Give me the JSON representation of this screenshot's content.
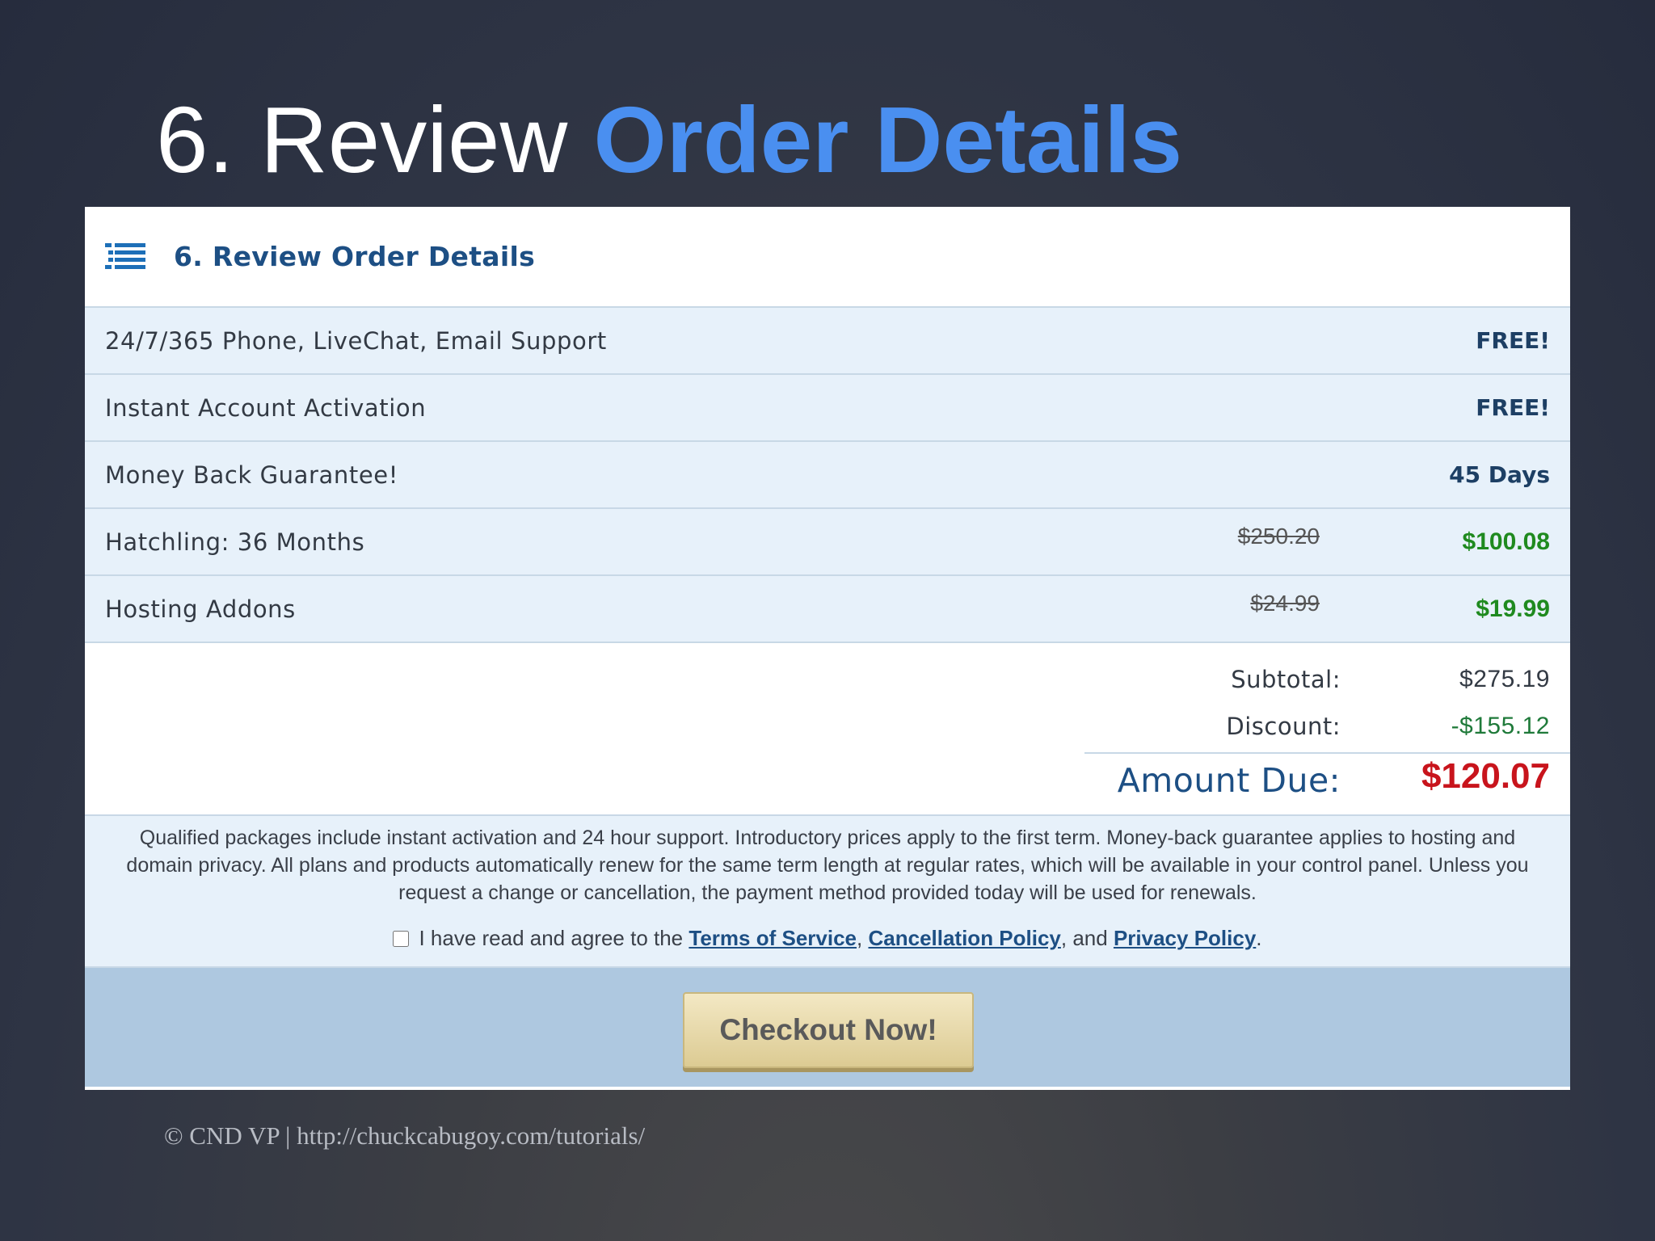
{
  "slide": {
    "title_prefix": "6. Review",
    "title_accent": "Order Details",
    "credit": "© CND VP | http://chuckcabugoy.com/tutorials/"
  },
  "panel": {
    "header": {
      "title": "6. Review Order Details",
      "icon": "list-icon"
    },
    "rows": [
      {
        "label": "24/7/365 Phone, LiveChat, Email Support",
        "old_price": "",
        "value": "FREE!"
      },
      {
        "label": "Instant Account Activation",
        "old_price": "",
        "value": "FREE!"
      },
      {
        "label": "Money Back Guarantee!",
        "old_price": "",
        "value": "45 Days"
      },
      {
        "label": "Hatchling: 36 Months",
        "old_price": "$250.20",
        "value": "$100.08"
      },
      {
        "label": "Hosting Addons",
        "old_price": "$24.99",
        "value": "$19.99"
      }
    ],
    "totals": {
      "subtotal_label": "Subtotal:",
      "subtotal_value": "$275.19",
      "discount_label": "Discount:",
      "discount_value": "-$155.12",
      "due_label": "Amount Due:",
      "due_value": "$120.07"
    },
    "terms": {
      "text": "Qualified packages include instant activation and 24 hour support. Introductory prices apply to the first term. Money-back guarantee applies to hosting and domain privacy. All plans and products automatically renew for the same term length at regular rates, which will be available in your control panel. Unless you request a change or cancellation, the payment method provided today will be used for renewals.",
      "agree_prefix": "I have read and agree to the",
      "tos_link": "Terms of Service",
      "comma": ",",
      "cancel_link": "Cancellation Policy",
      "and": ", and",
      "privacy_link": "Privacy Policy",
      "period": ".",
      "checked": false
    },
    "checkout_label": "Checkout Now!"
  },
  "colors": {
    "accent": "#4a8ff0",
    "header_blue": "#1d4f84",
    "price_green": "#1f8a1f",
    "due_red": "#c8141c",
    "button_gold": "#dccb93"
  }
}
